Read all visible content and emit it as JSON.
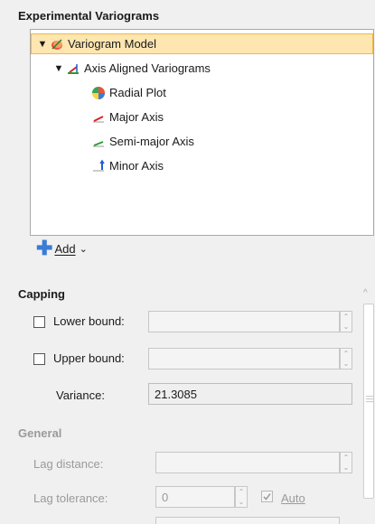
{
  "experimental_variograms": {
    "title": "Experimental Variograms",
    "tree": [
      {
        "label": "Variogram Model",
        "icon": "variogram-model-icon",
        "selected": true,
        "expanded": true
      },
      {
        "label": "Axis Aligned Variograms",
        "icon": "axis-aligned-icon",
        "expanded": true
      },
      {
        "label": "Radial Plot",
        "icon": "radial-plot-icon"
      },
      {
        "label": "Major Axis",
        "icon": "major-axis-icon"
      },
      {
        "label": "Semi-major Axis",
        "icon": "semi-major-axis-icon"
      },
      {
        "label": "Minor Axis",
        "icon": "minor-axis-icon"
      }
    ],
    "add_label": "Add"
  },
  "capping": {
    "title": "Capping",
    "lower_bound_label": "Lower bound:",
    "upper_bound_label": "Upper bound:",
    "variance_label": "Variance:",
    "variance_value": "21.3085"
  },
  "general": {
    "title": "General",
    "lag_distance_label": "Lag distance:",
    "lag_tolerance_label": "Lag tolerance:",
    "lag_tolerance_value": "0",
    "auto_label": "Auto"
  },
  "colors": {
    "selected_row": "#fde6b0",
    "accent_blue": "#3a7bd5"
  }
}
